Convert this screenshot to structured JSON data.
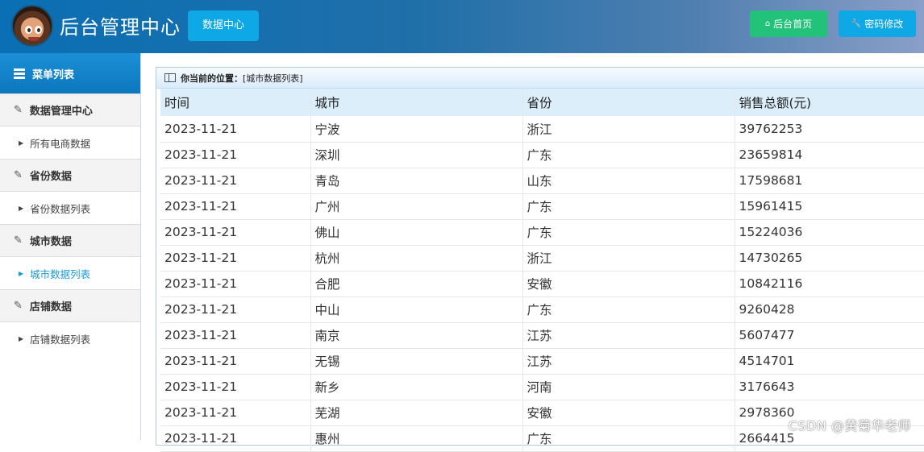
{
  "header": {
    "title": "后台管理中心",
    "datacenter_label": "数据中心",
    "home_label": "后台首页",
    "password_label": "密码修改"
  },
  "sidebar": {
    "menu_title": "菜单列表",
    "sections": [
      {
        "label": "数据管理中心",
        "sub": "所有电商数据"
      },
      {
        "label": "省份数据",
        "sub": "省份数据列表"
      },
      {
        "label": "城市数据",
        "sub": "城市数据列表"
      },
      {
        "label": "店铺数据",
        "sub": "店铺数据列表"
      }
    ]
  },
  "panel": {
    "location_label": "你当前的位置：",
    "location_value": "[城市数据列表]"
  },
  "table": {
    "headers": [
      "时间",
      "城市",
      "省份",
      "销售总额(元)"
    ],
    "rows": [
      [
        "2023-11-21",
        "宁波",
        "浙江",
        "39762253"
      ],
      [
        "2023-11-21",
        "深圳",
        "广东",
        "23659814"
      ],
      [
        "2023-11-21",
        "青岛",
        "山东",
        "17598681"
      ],
      [
        "2023-11-21",
        "广州",
        "广东",
        "15961415"
      ],
      [
        "2023-11-21",
        "佛山",
        "广东",
        "15224036"
      ],
      [
        "2023-11-21",
        "杭州",
        "浙江",
        "14730265"
      ],
      [
        "2023-11-21",
        "合肥",
        "安徽",
        "10842116"
      ],
      [
        "2023-11-21",
        "中山",
        "广东",
        "9260428"
      ],
      [
        "2023-11-21",
        "南京",
        "江苏",
        "5607477"
      ],
      [
        "2023-11-21",
        "无锡",
        "江苏",
        "4514701"
      ],
      [
        "2023-11-21",
        "新乡",
        "河南",
        "3176643"
      ],
      [
        "2023-11-21",
        "芜湖",
        "安徽",
        "2978360"
      ],
      [
        "2023-11-21",
        "惠州",
        "广东",
        "2664415"
      ]
    ]
  },
  "watermark": "CSDN @黄菊华老师"
}
